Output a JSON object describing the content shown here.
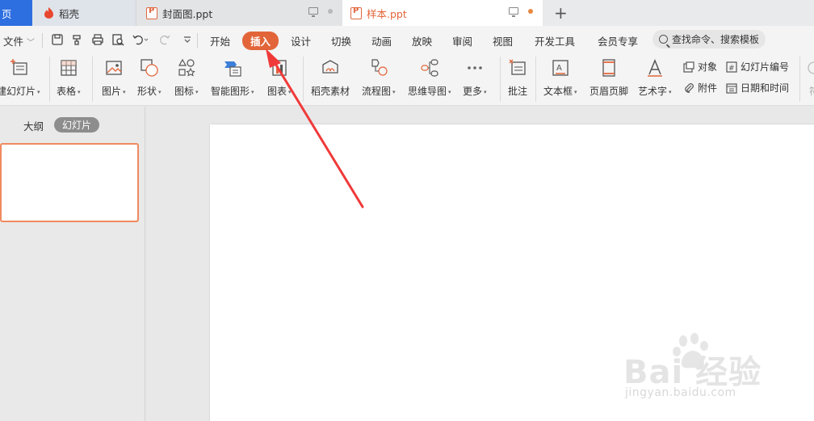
{
  "tabs": {
    "home_label": "页",
    "daoke_label": "稻壳",
    "doc1_label": "封面图.ppt",
    "doc2_label": "样本.ppt",
    "new_tab": "+"
  },
  "menu": {
    "file_label": "文件",
    "items": [
      "开始",
      "插入",
      "设计",
      "切换",
      "动画",
      "放映",
      "审阅",
      "视图",
      "开发工具",
      "会员专享"
    ],
    "active": "插入",
    "search_placeholder": "查找命令、搜索模板"
  },
  "ribbon": {
    "new_slide": "建幻灯片",
    "table": "表格",
    "picture": "图片",
    "shape": "形状",
    "icon": "图标",
    "smart_art": "智能图形",
    "chart": "图表",
    "daoke_material": "稻壳素材",
    "flowchart": "流程图",
    "mindmap": "思维导图",
    "more": "更多",
    "comment": "批注",
    "textbox": "文本框",
    "header_footer": "页眉页脚",
    "wordart": "艺术字",
    "object": "对象",
    "slide_number": "幻灯片编号",
    "attachment": "附件",
    "date_time": "日期和时间",
    "symbol": "符"
  },
  "panel": {
    "outline_tab": "大纲",
    "slides_tab": "幻灯片"
  },
  "watermark": {
    "brand_text": "Bai 经验",
    "url": "jingyan.baidu.com"
  },
  "colors": {
    "accent": "#e2653a",
    "home_tab": "#2d6ee0",
    "arrow": "#f03a3a"
  }
}
